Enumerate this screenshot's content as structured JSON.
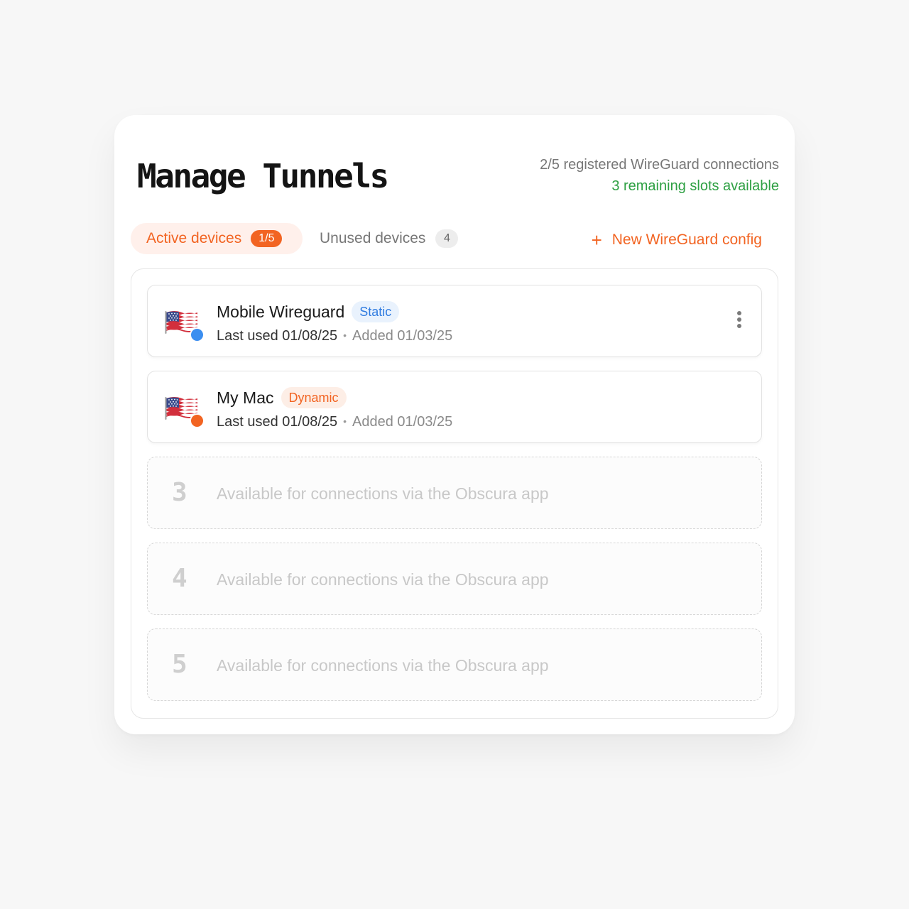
{
  "header": {
    "title": "Manage Tunnels",
    "registered_text": "2/5 registered WireGuard connections",
    "remaining_text": "3 remaining slots available"
  },
  "tabs": {
    "active": {
      "label": "Active devices",
      "count": "1/5"
    },
    "unused": {
      "label": "Unused devices",
      "count": "4"
    }
  },
  "new_config": {
    "icon": "plus-icon",
    "label": "New WireGuard config"
  },
  "colors": {
    "accent": "#f26422",
    "success": "#2ea043",
    "static_badge": "#2f7be0",
    "dynamic_dot": "#f26422",
    "static_dot": "#3b8ef0"
  },
  "devices": [
    {
      "name": "Mobile Wireguard",
      "badge": "Static",
      "last_used": "Last used 01/08/25",
      "separator": "•",
      "added": "Added 01/03/25",
      "flag_icon": "us-flag-icon"
    },
    {
      "name": "My Mac",
      "badge": "Dynamic",
      "last_used": "Last used 01/08/25",
      "separator": "•",
      "added": "Added 01/03/25",
      "flag_icon": "us-flag-icon"
    }
  ],
  "slots": [
    {
      "number": "3",
      "text": "Available for connections via the Obscura app"
    },
    {
      "number": "4",
      "text": "Available for connections via the Obscura app"
    },
    {
      "number": "5",
      "text": "Available for connections via the Obscura app"
    }
  ]
}
